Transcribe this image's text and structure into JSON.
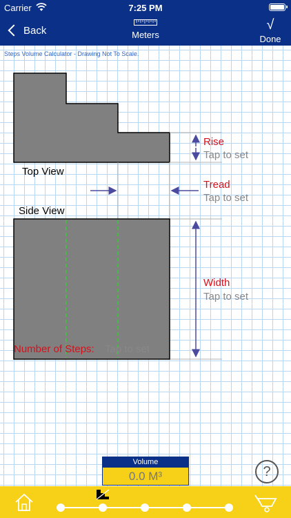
{
  "status_bar": {
    "carrier": "Carrier",
    "time": "7:25 PM"
  },
  "nav": {
    "back_label": "Back",
    "title": "Meters",
    "done_label": "Done",
    "done_icon": "√"
  },
  "canvas": {
    "subtitle": "Steps Volume Calculator - Drawing Not To Scale.",
    "top_view_label": "Top View",
    "side_view_label": "Side View",
    "rise": {
      "title": "Rise",
      "value": "Tap to set"
    },
    "tread": {
      "title": "Tread",
      "value": "Tap to set"
    },
    "width": {
      "title": "Width",
      "value": "Tap to set"
    },
    "steps": {
      "title": "Number of Steps:",
      "value": "Tap to set"
    }
  },
  "volume": {
    "header": "Volume",
    "value": "0.0 M³"
  },
  "help": {
    "label": "?"
  },
  "colors": {
    "nav": "#0a3087",
    "accent_red": "#d4111c",
    "yellow": "#f7d117",
    "grid": "#b9d6f1",
    "shape": "#808080",
    "arrow": "#4a4a9e",
    "dashed": "#33cc33"
  },
  "icons": [
    "wifi-icon",
    "battery-icon",
    "chevron-left-icon",
    "ruler-icon",
    "check-icon",
    "help-icon",
    "home-icon",
    "steps-icon",
    "wheelbarrow-icon"
  ]
}
